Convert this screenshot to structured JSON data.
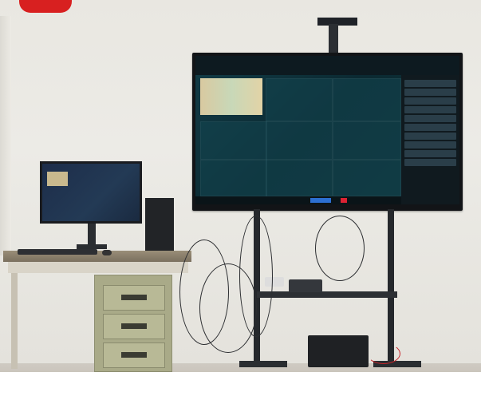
{
  "scene": {
    "colors": {
      "wall": "#ecebe6",
      "floor": "#c6c0b6",
      "tv_screen_accent": "#123c47",
      "monitor_screen_accent": "#233a55",
      "badge_red": "#d82020",
      "cabinet": "#a9aa88",
      "desk_top": "#8b806b"
    },
    "objects": [
      "wall-mounted-tv-stand",
      "large-tv-display",
      "desktop-monitor",
      "pc-tower",
      "desk",
      "filing-cabinet",
      "ups-battery",
      "network-device",
      "cables"
    ]
  }
}
